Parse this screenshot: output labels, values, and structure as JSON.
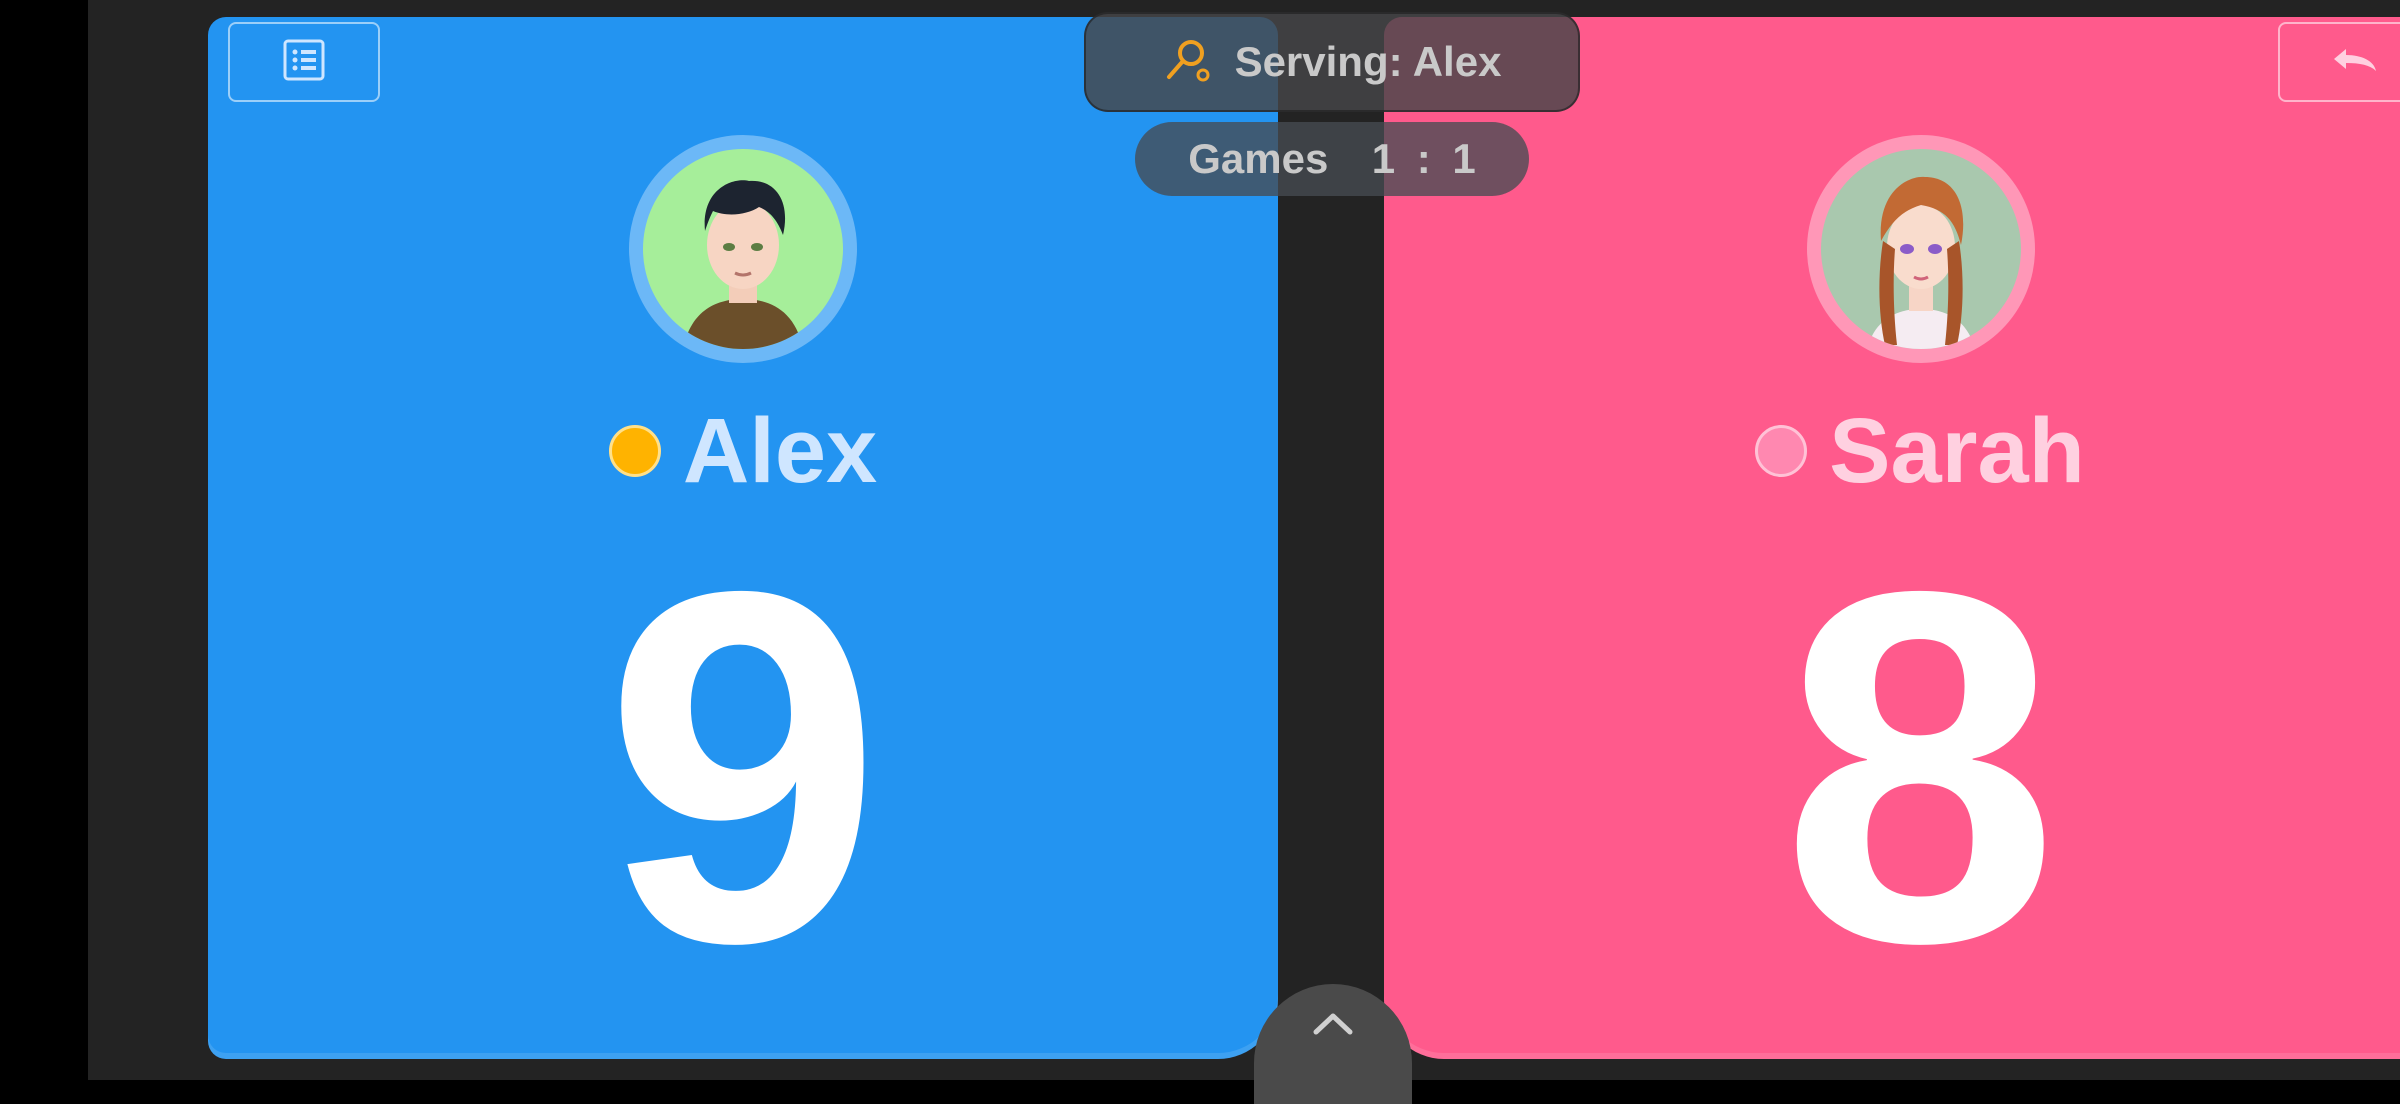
{
  "serving": {
    "label": "Serving: Alex",
    "icon": "racket-icon",
    "icon_color": "#f0a020"
  },
  "games": {
    "label": "Games  1 : 1"
  },
  "players": [
    {
      "name": "Alex",
      "score": "9",
      "color": "#2394f1",
      "serving": true,
      "indicator_color": "#ffb300"
    },
    {
      "name": "Sarah",
      "score": "8",
      "color": "#ff5a8c",
      "serving": false,
      "indicator_color": "#ff88b0"
    }
  ],
  "buttons": {
    "left_icon": "list-icon",
    "right_icon": "undo-icon",
    "bottom_icon": "chevron-up-icon"
  }
}
